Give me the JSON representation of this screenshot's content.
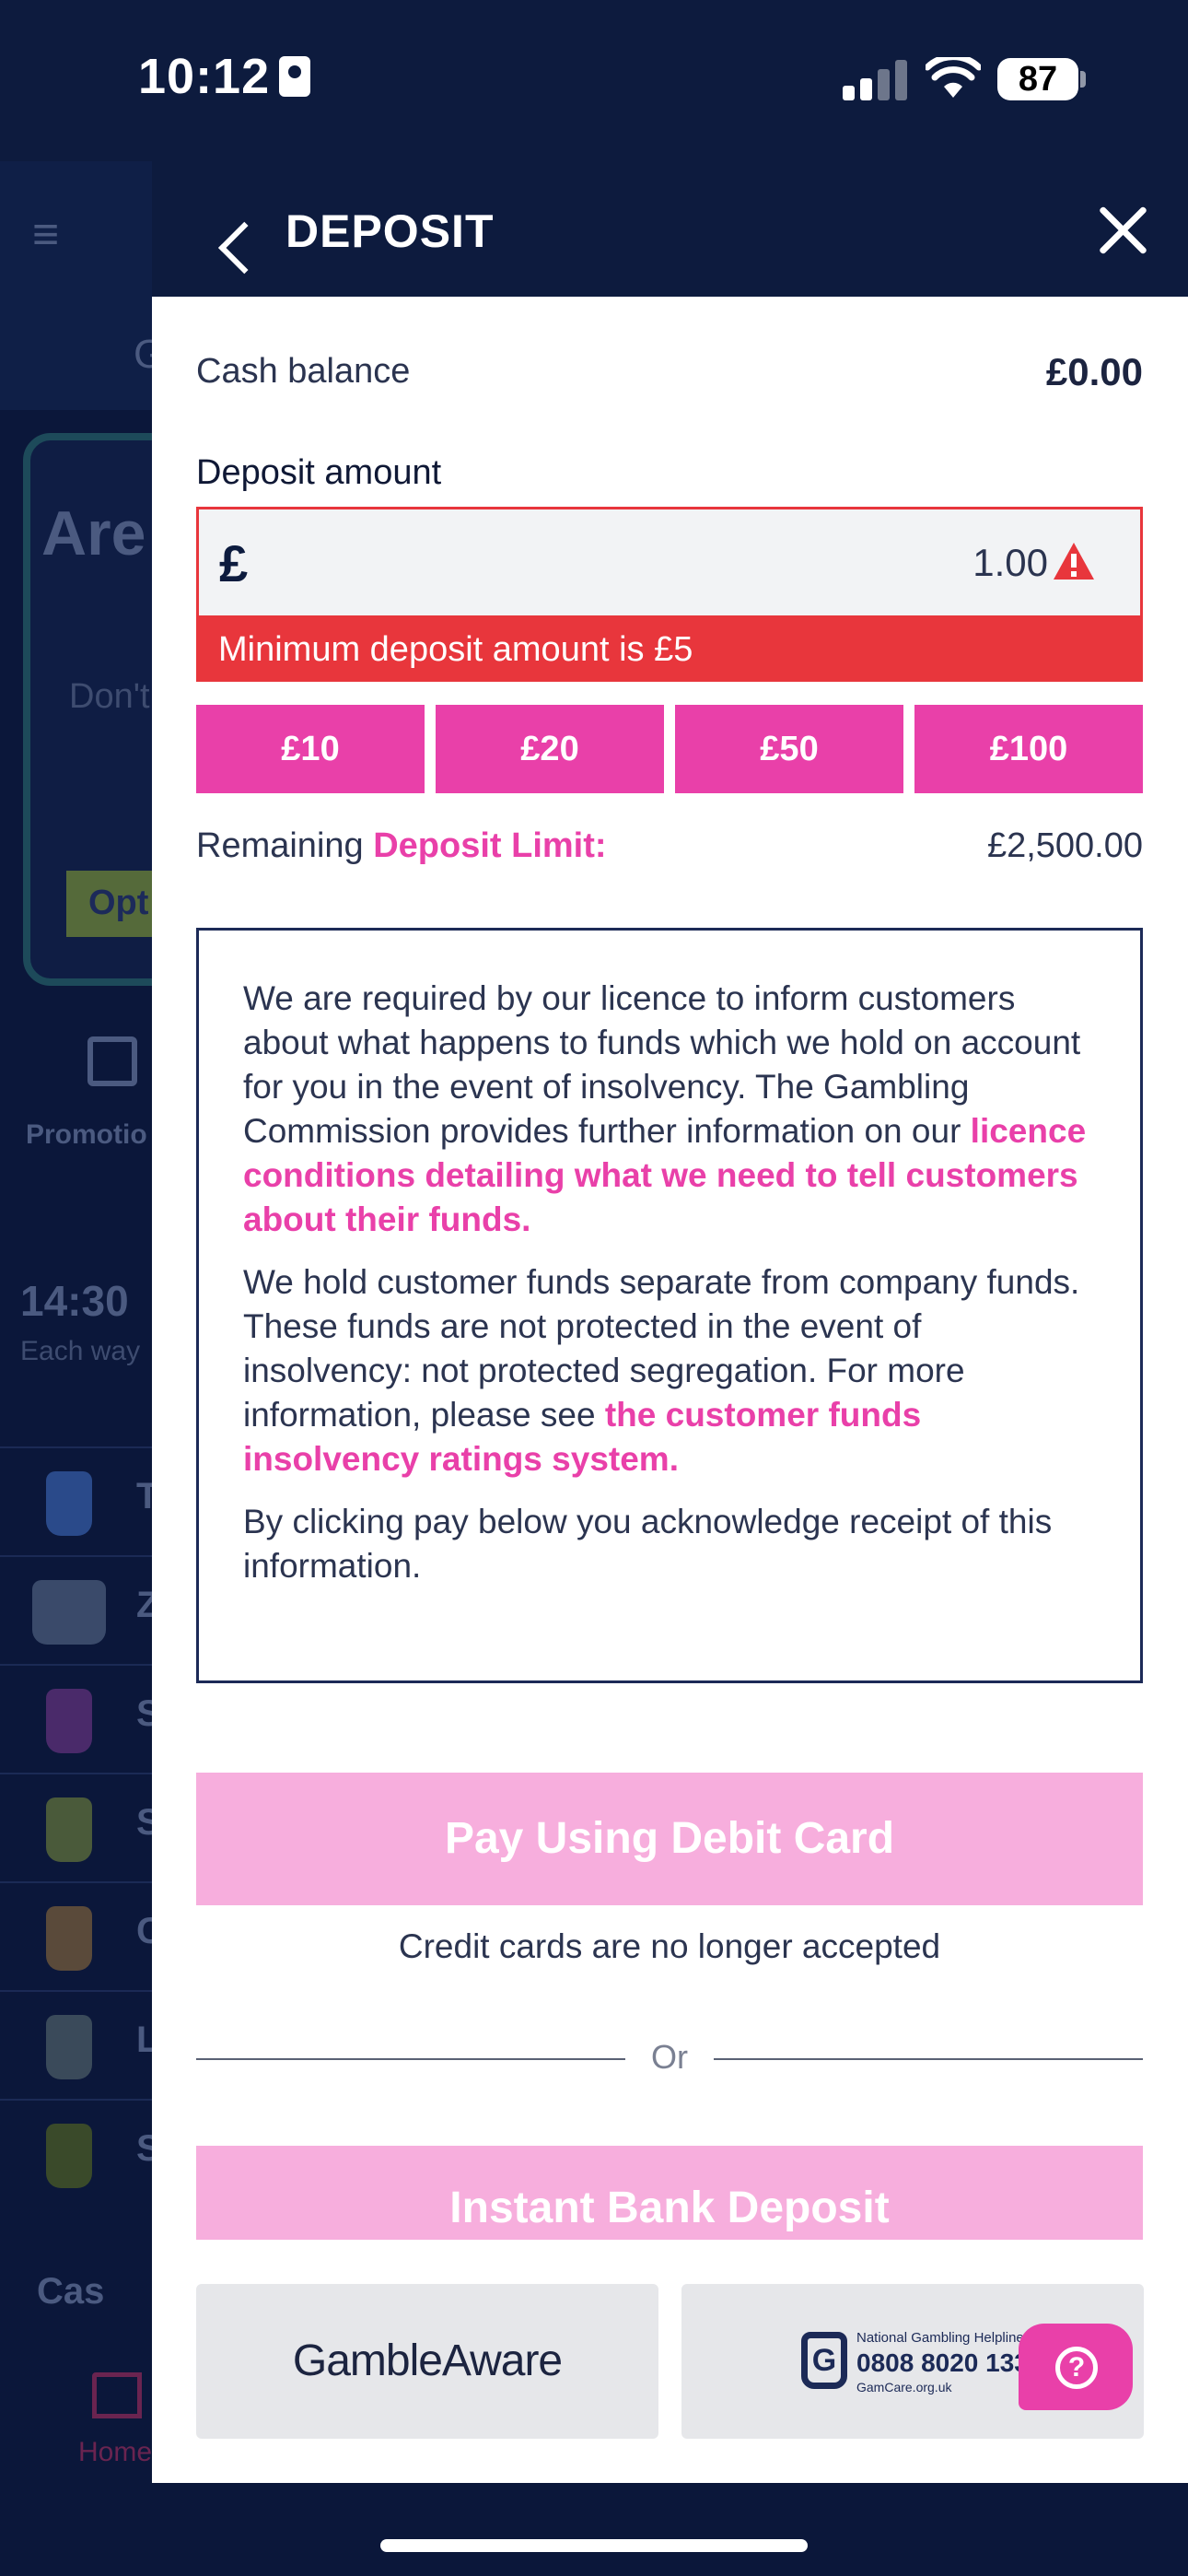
{
  "status_bar": {
    "time": "10:12",
    "battery": "87"
  },
  "background": {
    "menu_icon": "menu-search-icon",
    "tab_letter": "G",
    "promo_title": "Are",
    "promo_sub": "Don't",
    "promo_button": "Opt",
    "promotions_label": "Promotio",
    "race_time": "14:30",
    "race_sub": "Each way",
    "runner_letters": [
      "T",
      "Z",
      "S",
      "S",
      "C",
      "L",
      "S"
    ],
    "casino_label": "Cas",
    "home_label": "Home"
  },
  "header": {
    "title": "DEPOSIT",
    "back_icon": "chevron-left-icon",
    "close_icon": "close-icon"
  },
  "balance": {
    "label": "Cash balance",
    "value": "£0.00"
  },
  "deposit": {
    "label": "Deposit amount",
    "currency": "£",
    "value": "1.00",
    "error": "Minimum deposit amount is £5",
    "quick_amounts": [
      "£10",
      "£20",
      "£50",
      "£100"
    ]
  },
  "limit": {
    "prefix": "Remaining",
    "link": "Deposit Limit:",
    "value": "£2,500.00"
  },
  "info": {
    "p1_text": "We are required by our licence to inform customers about what happens to funds which we hold on account for you in the event of insolvency. The Gambling Commission provides further information on our ",
    "p1_link": "licence conditions detailing what we need to tell customers about their funds.",
    "p2_text": "We hold customer funds separate from company funds. These funds are not protected in the event of insolvency: not protected segregation. For more information, please see ",
    "p2_link": "the customer funds insolvency ratings system.",
    "p3_text": "By clicking pay below you acknowledge receipt of this information."
  },
  "actions": {
    "pay_debit": "Pay Using Debit Card",
    "credit_note": "Credit cards are no longer accepted",
    "or": "Or",
    "bank_deposit": "Instant Bank Deposit"
  },
  "footer": {
    "gambleaware": "GambleAware",
    "gamcare_small": "National Gambling Helpline",
    "gamcare_phone": "0808 8020 133",
    "gamcare_url": "GamCare.org.uk",
    "gamcare_logo_letter": "G",
    "help_icon": "question-icon",
    "help_glyph": "?"
  },
  "colors": {
    "navy": "#0d1b3e",
    "pink": "#e940a9",
    "pink_disabled": "#f7aedd",
    "error_red": "#e8363c"
  }
}
